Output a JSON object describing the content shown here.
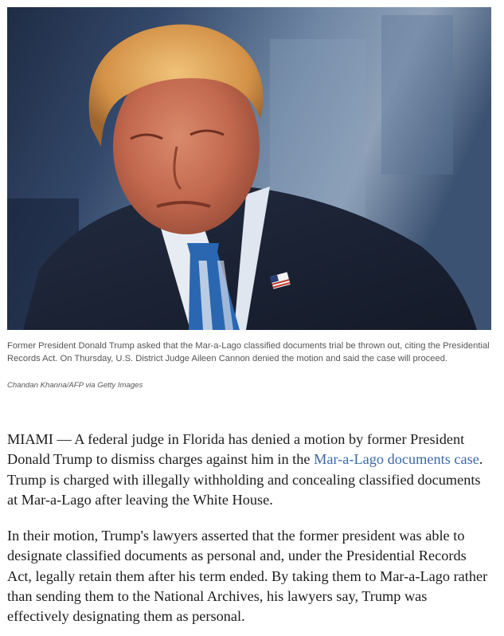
{
  "photo": {
    "icon": "portrait-photo",
    "colors": {
      "background": "#2c3f5e",
      "suit": "#1c2438",
      "tie": "#2c6ab4",
      "shirt": "#e9eef5",
      "skin": "#c9755a",
      "hair": "#d79a4e"
    }
  },
  "caption": {
    "text": "Former President Donald Trump asked that the Mar-a-Lago classified documents trial be thrown out, citing the Presidential Records Act. On Thursday, U.S. District Judge Aileen Cannon denied the motion and said the case will proceed.",
    "credit": "Chandan Khanna/AFP via Getty Images"
  },
  "article": {
    "p1_before": "MIAMI — A federal judge in Florida has denied a motion by former President Donald Trump to dismiss charges against him in the ",
    "p1_link": "Mar-a-Lago documents case",
    "p1_after": ". Trump is charged with illegally withholding and concealing classified documents at Mar-a-Lago after leaving the White House.",
    "p2": "In their motion, Trump's lawyers asserted that the former president was able to designate classified documents as personal and, under the Presidential Records Act, legally retain them after his term ended. By taking them to Mar-a-Lago rather than sending them to the National Archives, his lawyers say, Trump was effectively designating them as personal.",
    "link_color": "#3b68a8"
  }
}
